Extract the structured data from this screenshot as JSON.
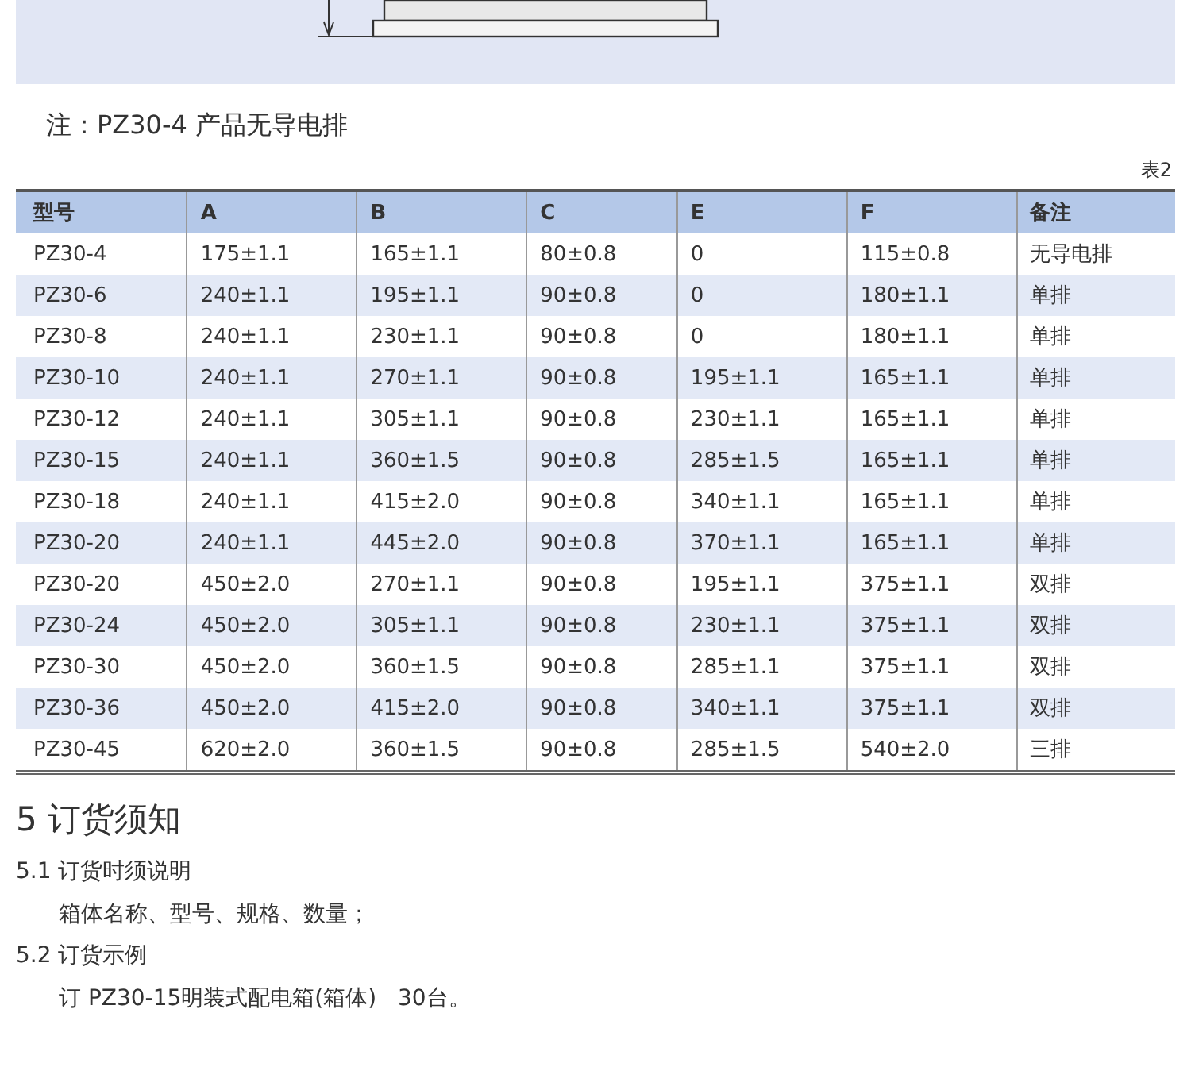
{
  "note": "注：PZ30-4 产品无导电排",
  "table_caption": "表2",
  "table": {
    "columns": [
      "型号",
      "A",
      "B",
      "C",
      "E",
      "F",
      "备注"
    ],
    "rows": [
      [
        "PZ30-4",
        "175±1.1",
        "165±1.1",
        "80±0.8",
        "0",
        "115±0.8",
        "无导电排"
      ],
      [
        "PZ30-6",
        "240±1.1",
        "195±1.1",
        "90±0.8",
        "0",
        "180±1.1",
        "单排"
      ],
      [
        "PZ30-8",
        "240±1.1",
        "230±1.1",
        "90±0.8",
        "0",
        "180±1.1",
        "单排"
      ],
      [
        "PZ30-10",
        "240±1.1",
        "270±1.1",
        "90±0.8",
        "195±1.1",
        "165±1.1",
        "单排"
      ],
      [
        "PZ30-12",
        "240±1.1",
        "305±1.1",
        "90±0.8",
        "230±1.1",
        "165±1.1",
        "单排"
      ],
      [
        "PZ30-15",
        "240±1.1",
        "360±1.5",
        "90±0.8",
        "285±1.5",
        "165±1.1",
        "单排"
      ],
      [
        "PZ30-18",
        "240±1.1",
        "415±2.0",
        "90±0.8",
        "340±1.1",
        "165±1.1",
        "单排"
      ],
      [
        "PZ30-20",
        "240±1.1",
        "445±2.0",
        "90±0.8",
        "370±1.1",
        "165±1.1",
        "单排"
      ],
      [
        "PZ30-20",
        "450±2.0",
        "270±1.1",
        "90±0.8",
        "195±1.1",
        "375±1.1",
        "双排"
      ],
      [
        "PZ30-24",
        "450±2.0",
        "305±1.1",
        "90±0.8",
        "230±1.1",
        "375±1.1",
        "双排"
      ],
      [
        "PZ30-30",
        "450±2.0",
        "360±1.5",
        "90±0.8",
        "285±1.1",
        "375±1.1",
        "双排"
      ],
      [
        "PZ30-36",
        "450±2.0",
        "415±2.0",
        "90±0.8",
        "340±1.1",
        "375±1.1",
        "双排"
      ],
      [
        "PZ30-45",
        "620±2.0",
        "360±1.5",
        "90±0.8",
        "285±1.5",
        "540±2.0",
        "三排"
      ]
    ]
  },
  "section": {
    "heading": "5 订货须知",
    "items": [
      {
        "kind": "subheading",
        "text": "5.1 订货时须说明"
      },
      {
        "kind": "body",
        "text": "箱体名称、型号、规格、数量；"
      },
      {
        "kind": "subheading",
        "text": "5.2 订货示例"
      },
      {
        "kind": "body",
        "text": "订 PZ30-15明装式配电箱(箱体)   30台。"
      }
    ]
  }
}
